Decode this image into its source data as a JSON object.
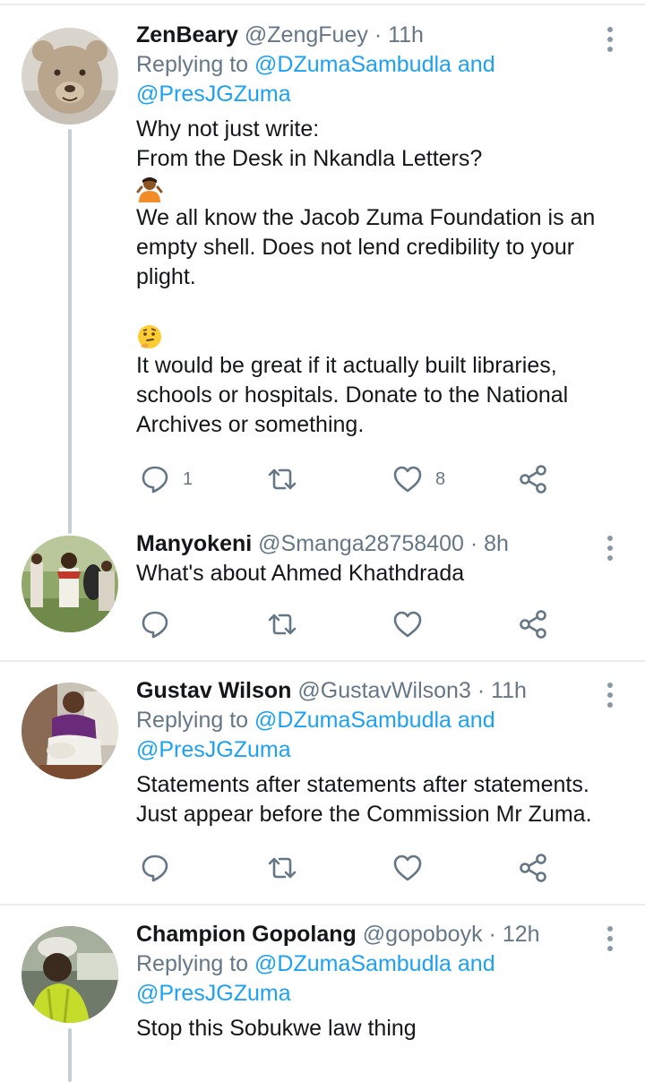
{
  "tweets": [
    {
      "name": "ZenBeary",
      "handle": "@ZengFuey",
      "dot": "·",
      "time": "11h",
      "reply_prefix": "Replying to",
      "reply_to_1": "@DZumaSambudla and",
      "reply_to_2": "@PresJGZuma",
      "text_1": "Why not just write:",
      "text_2": "From the Desk in Nkandla Letters?",
      "emoji_1": "person-shrugging-emoji",
      "text_3": "We all know the Jacob Zuma Foundation is an empty shell. Does not lend credibility to your plight.",
      "emoji_2": "thinking-face-emoji",
      "text_4": "It would be great if it actually built libraries, schools or hospitals. Donate to the National Archives or something.",
      "reply_count": "1",
      "like_count": "8"
    },
    {
      "name": "Manyokeni",
      "handle": "@Smanga28758400",
      "dot": "·",
      "time": "8h",
      "text_1": "What's about Ahmed Khathdrada"
    },
    {
      "name": "Gustav Wilson",
      "handle": "@GustavWilson3",
      "dot": "·",
      "time": "11h",
      "reply_prefix": "Replying to",
      "reply_to_1": "@DZumaSambudla and",
      "reply_to_2": "@PresJGZuma",
      "text_1": "Statements after statements after statements. Just appear before the Commission Mr Zuma."
    },
    {
      "name": "Champion Gopolang",
      "handle": "@gopoboyk",
      "dot": "·",
      "time": "12h",
      "reply_prefix": "Replying to",
      "reply_to_1": "@DZumaSambudla and",
      "reply_to_2": "@PresJGZuma",
      "text_1": "Stop this Sobukwe law thing"
    }
  ],
  "colors": {
    "link": "#1da1f2",
    "secondary_text": "#657786",
    "divider": "#e6ecf0"
  }
}
